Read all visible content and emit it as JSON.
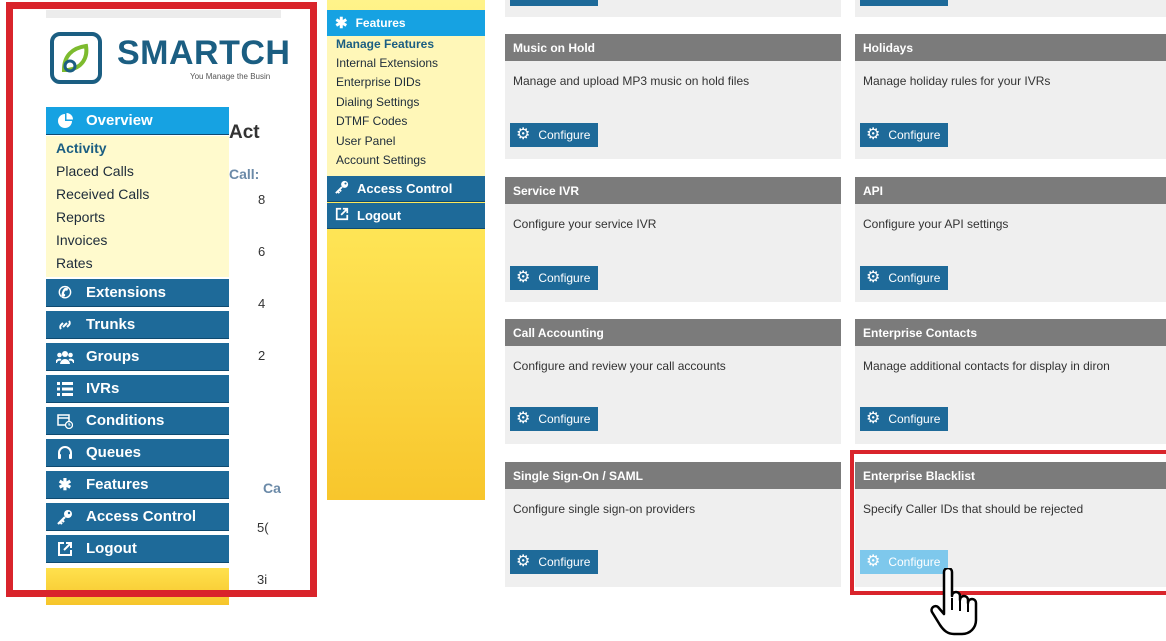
{
  "logo": {
    "brand": "SMARTCH",
    "tagline": "You Manage the Busin"
  },
  "left_nav": {
    "overview": "Overview",
    "overview_items": [
      "Activity",
      "Placed Calls",
      "Received Calls",
      "Reports",
      "Invoices",
      "Rates"
    ],
    "items": [
      "Extensions",
      "Trunks",
      "Groups",
      "IVRs",
      "Conditions",
      "Queues",
      "Features",
      "Access Control",
      "Logout"
    ]
  },
  "activity_partial": {
    "title": "Act",
    "calls_label": "Call:",
    "y_ticks": [
      "8",
      "6",
      "4",
      "2"
    ],
    "ca_label": "Ca",
    "val1": "5(",
    "val2": "3i"
  },
  "mid_nav": {
    "features": "Features",
    "feature_items": [
      "Manage Features",
      "Internal Extensions",
      "Enterprise DIDs",
      "Dialing Settings",
      "DTMF Codes",
      "User Panel",
      "Account Settings"
    ],
    "access_control": "Access Control",
    "logout": "Logout"
  },
  "cards": [
    {
      "title": "Music on Hold",
      "desc": "Manage and upload MP3 music on hold files",
      "button": "Configure"
    },
    {
      "title": "Holidays",
      "desc": "Manage holiday rules for your IVRs",
      "button": "Configure"
    },
    {
      "title": "Service IVR",
      "desc": "Configure your service IVR",
      "button": "Configure"
    },
    {
      "title": "API",
      "desc": "Configure your API settings",
      "button": "Configure"
    },
    {
      "title": "Call Accounting",
      "desc": "Configure and review your call accounts",
      "button": "Configure"
    },
    {
      "title": "Enterprise Contacts",
      "desc": "Manage additional contacts for display in diron",
      "button": "Configure"
    },
    {
      "title": "Single Sign-On / SAML",
      "desc": "Configure single sign-on providers",
      "button": "Configure"
    },
    {
      "title": "Enterprise Blacklist",
      "desc": "Specify Caller IDs that should be rejected",
      "button": "Configure"
    }
  ],
  "colors": {
    "nav_blue": "#1e6a99",
    "active_blue": "#16a2e2",
    "highlight_red": "#d9242b",
    "card_head_gray": "#7b7b7b"
  }
}
